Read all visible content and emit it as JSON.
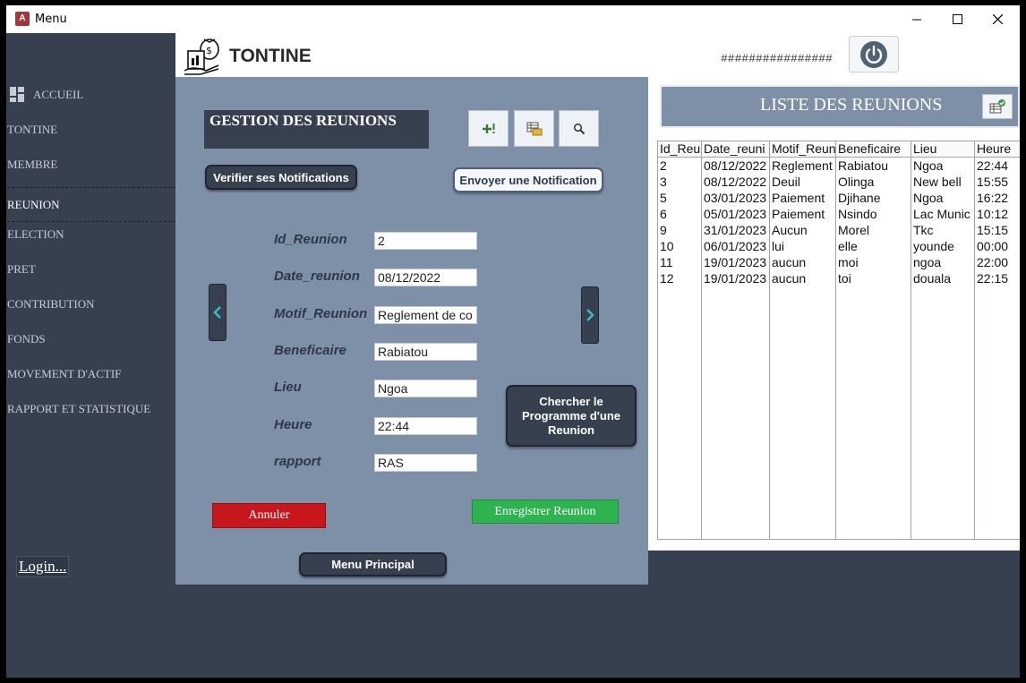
{
  "window": {
    "title": "Menu",
    "app_icon_text": "A"
  },
  "header": {
    "app_name": "TONTINE",
    "user_text": "################",
    "logout_icon": "power-icon"
  },
  "sidebar": {
    "items": [
      {
        "label": "ACCUEIL",
        "icon": "dashboard-icon"
      },
      {
        "label": "TONTINE"
      },
      {
        "label": "MEMBRE"
      },
      {
        "label": "REUNION",
        "active": true
      },
      {
        "label": "ELECTION"
      },
      {
        "label": "PRET"
      },
      {
        "label": "CONTRIBUTION"
      },
      {
        "label": "FONDS"
      },
      {
        "label": "MOVEMENT D'ACTIF"
      },
      {
        "label": "RAPPORT ET STATISTIQUE"
      }
    ],
    "login_label": "Login..."
  },
  "form": {
    "title": "GESTION DES REUNIONS",
    "toolbar": {
      "add_icon": "add-icon",
      "list_icon": "table-icon",
      "search_icon": "search-icon"
    },
    "check_notifications_label": "Verifier ses Notifications",
    "send_notification_label": "Envoyer une Notification",
    "fields": [
      {
        "label": "Id_Reunion",
        "value": "2"
      },
      {
        "label": "Date_reunion",
        "value": "08/12/2022"
      },
      {
        "label": "Motif_Reunion",
        "value": "Reglement de co"
      },
      {
        "label": "Beneficaire",
        "value": "Rabiatou"
      },
      {
        "label": "Lieu",
        "value": "Ngoa"
      },
      {
        "label": "Heure",
        "value": "22:44"
      },
      {
        "label": "rapport",
        "value": "RAS"
      }
    ],
    "search_program_label": "Chercher le Programme d'une Reunion",
    "cancel_label": "Annuler",
    "save_label": "Enregistrer Reunion",
    "main_menu_label": "Menu Principal"
  },
  "list": {
    "title": "LISTE DES REUNIONS",
    "columns": [
      "Id_Reu",
      "Date_reuni",
      "Motif_Reun",
      "Beneficaire",
      "Lieu",
      "Heure"
    ],
    "rows": [
      [
        "2",
        "08/12/2022",
        "Reglement",
        "Rabiatou",
        "Ngoa",
        "22:44"
      ],
      [
        "3",
        "08/12/2022",
        "Deuil",
        "Olinga",
        "New bell",
        "15:55"
      ],
      [
        "5",
        "03/01/2023",
        "Paiement",
        "Djihane",
        "Ngoa",
        "16:22"
      ],
      [
        "6",
        "05/01/2023",
        "Paiement",
        "Nsindo",
        "Lac Munic",
        "10:12"
      ],
      [
        "9",
        "31/01/2023",
        "Aucun",
        "Morel",
        "Tkc",
        "15:15"
      ],
      [
        "10",
        "06/01/2023",
        "lui",
        "elle",
        "younde",
        "00:00"
      ],
      [
        "11",
        "19/01/2023",
        "aucun",
        "moi",
        "ngoa",
        "22:00"
      ],
      [
        "12",
        "19/01/2023",
        "aucun",
        "toi",
        "douala",
        "22:15"
      ]
    ]
  }
}
